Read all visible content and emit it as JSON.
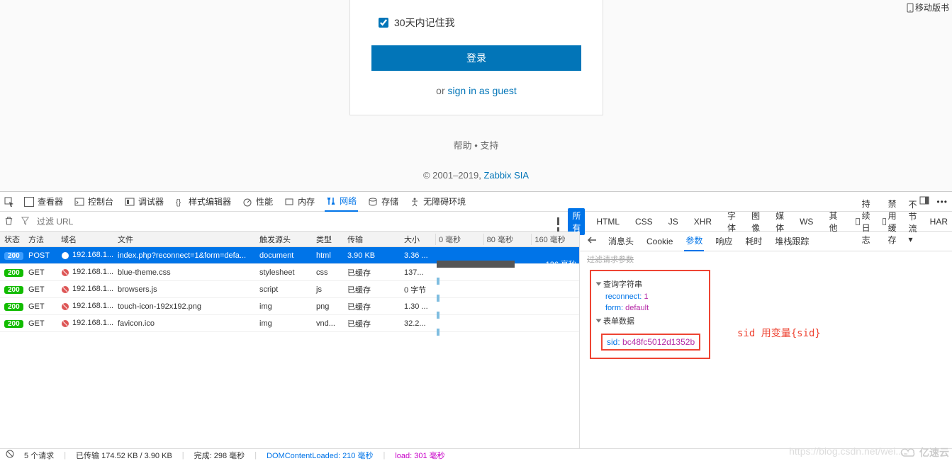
{
  "top_link": {
    "label": "移动版书"
  },
  "login": {
    "remember_label": "30天内记住我",
    "login_btn": "登录",
    "or_text": "or ",
    "guest_link": "sign in as guest",
    "help": "帮助",
    "support": "支持",
    "copyright": "© 2001–2019, ",
    "company": "Zabbix SIA"
  },
  "toolbar": {
    "inspector": "查看器",
    "console": "控制台",
    "debugger": "调试器",
    "style_editor": "样式编辑器",
    "performance": "性能",
    "memory": "内存",
    "network": "网络",
    "storage": "存储",
    "accessibility": "无障碍环境"
  },
  "filter": {
    "placeholder": "过滤 URL",
    "all": "所有",
    "html": "HTML",
    "css": "CSS",
    "js": "JS",
    "xhr": "XHR",
    "fonts": "字体",
    "images": "图像",
    "media": "媒体",
    "ws": "WS",
    "other": "其他",
    "persist": "持续日志",
    "disable_cache": "禁用缓存",
    "throttle": "不节流",
    "har": "HAR"
  },
  "columns": {
    "status": "状态",
    "method": "方法",
    "domain": "域名",
    "file": "文件",
    "cause": "触发源头",
    "type": "类型",
    "transfer": "传输",
    "size": "大小",
    "t0": "0 毫秒",
    "t1": "80 毫秒",
    "t2": "160 毫秒"
  },
  "rows": [
    {
      "status": "200",
      "method": "POST",
      "domain": "192.168.1...",
      "file": "index.php?reconnect=1&form=defa...",
      "cause": "document",
      "type": "html",
      "transfer": "3.90 KB",
      "size": "3.36 ...",
      "tl_label": "126 毫秒",
      "selected": true
    },
    {
      "status": "200",
      "method": "GET",
      "domain": "192.168.1...",
      "file": "blue-theme.css",
      "cause": "stylesheet",
      "type": "css",
      "transfer": "已缓存",
      "size": "137..."
    },
    {
      "status": "200",
      "method": "GET",
      "domain": "192.168.1...",
      "file": "browsers.js",
      "cause": "script",
      "type": "js",
      "transfer": "已缓存",
      "size": "0 字节"
    },
    {
      "status": "200",
      "method": "GET",
      "domain": "192.168.1...",
      "file": "touch-icon-192x192.png",
      "cause": "img",
      "type": "png",
      "transfer": "已缓存",
      "size": "1.30 ..."
    },
    {
      "status": "200",
      "method": "GET",
      "domain": "192.168.1...",
      "file": "favicon.ico",
      "cause": "img",
      "type": "vnd...",
      "transfer": "已缓存",
      "size": "32.2..."
    }
  ],
  "detail": {
    "tabs": {
      "headers": "消息头",
      "cookie": "Cookie",
      "params": "参数",
      "response": "响应",
      "timing": "耗时",
      "stack": "堆栈跟踪"
    },
    "filter_line": "过滤请求参数",
    "query_title": "查询字符串",
    "reconnect_k": "reconnect:",
    "reconnect_v": "1",
    "form_k": "form:",
    "form_v": "default",
    "formdata_title": "表单数据",
    "sid_k": "sid:",
    "sid_v": "bc48fc5012d1352b"
  },
  "annotation": "sid 用变量{sid}",
  "status_bar": {
    "requests": "5 个请求",
    "transferred": "已传输 174.52 KB / 3.90 KB",
    "done": "完成: 298 毫秒",
    "dcl_label": "DOMContentLoaded: ",
    "dcl_val": "210 毫秒",
    "load_label": "load: ",
    "load_val": "301 毫秒"
  },
  "watermark": "https://blog.csdn.net/wei...",
  "brand": "亿速云"
}
